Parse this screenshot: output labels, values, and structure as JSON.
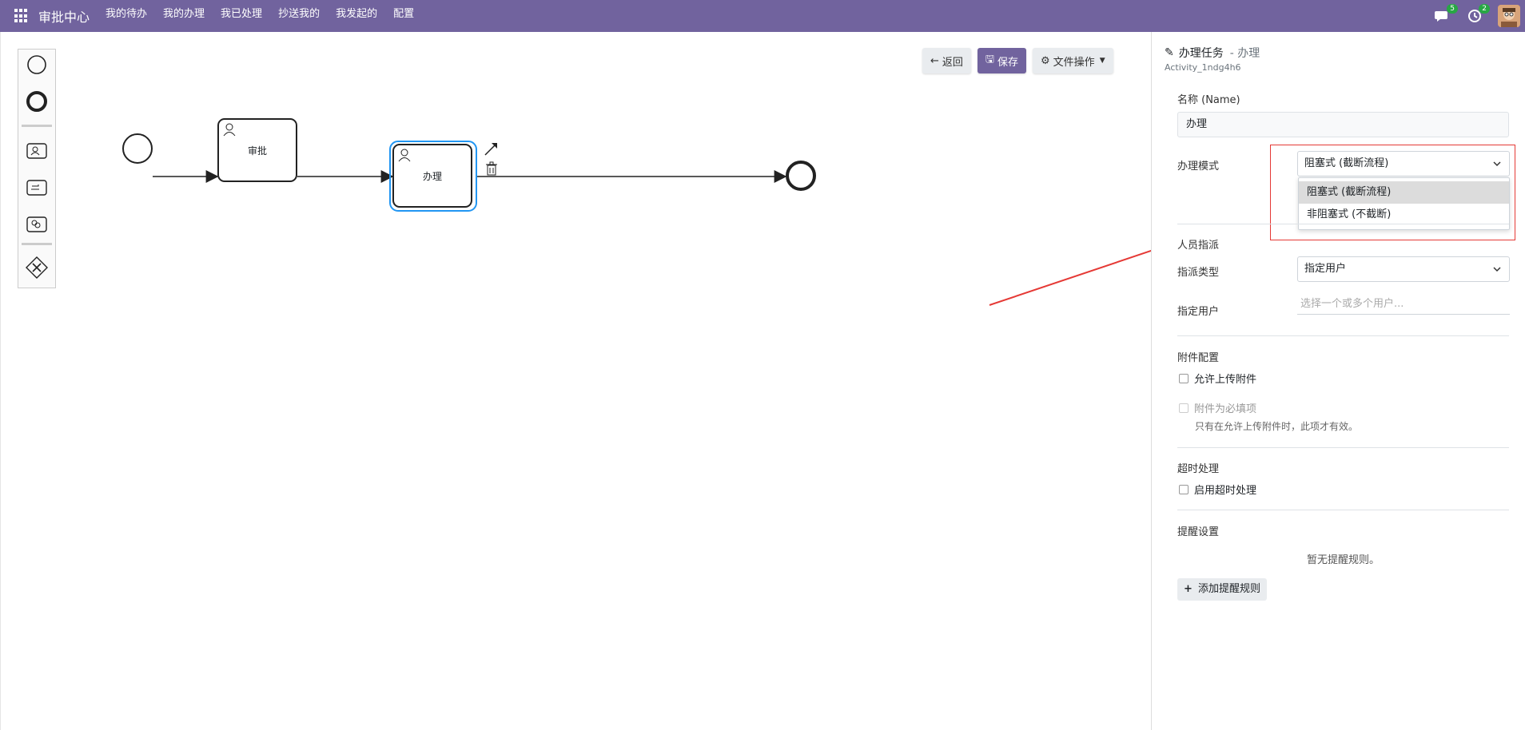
{
  "nav": {
    "brand": "审批中心",
    "menu": [
      "我的待办",
      "我的办理",
      "我已处理",
      "抄送我的",
      "我发起的",
      "配置"
    ],
    "chat_badge": "5",
    "activity_badge": "2",
    "icons": [
      "apps-grid-icon",
      "chat-icon",
      "clock-icon",
      "avatar"
    ]
  },
  "toolbar": {
    "back": "返回",
    "save": "保存",
    "file_ops": "文件操作"
  },
  "diagram": {
    "task1": "审批",
    "task2": "办理"
  },
  "panel": {
    "title": "办理任务",
    "subtitle": "- 办理",
    "activity_id": "Activity_1ndg4h6",
    "name_label": "名称 (Name)",
    "name_value": "办理",
    "mode_label": "办理模式",
    "mode_value": "阻塞式 (截断流程)",
    "mode_options": [
      "阻塞式 (截断流程)",
      "非阻塞式 (不截断)"
    ],
    "assign_section": "人员指派",
    "assign_type_label": "指派类型",
    "assign_type_value": "指定用户",
    "assign_user_label": "指定用户",
    "assign_user_placeholder": "选择一个或多个用户...",
    "attach_section": "附件配置",
    "allow_upload": "允许上传附件",
    "attach_required": "附件为必填项",
    "attach_hint": "只有在允许上传附件时，此项才有效。",
    "timeout_section": "超时处理",
    "enable_timeout": "启用超时处理",
    "reminder_section": "提醒设置",
    "no_rules": "暂无提醒规则。",
    "add_rule": "添加提醒规则"
  },
  "colors": {
    "nav_bg": "#71639e",
    "primary": "#71639e",
    "annotation": "#e53935",
    "selection": "#2196f3"
  }
}
